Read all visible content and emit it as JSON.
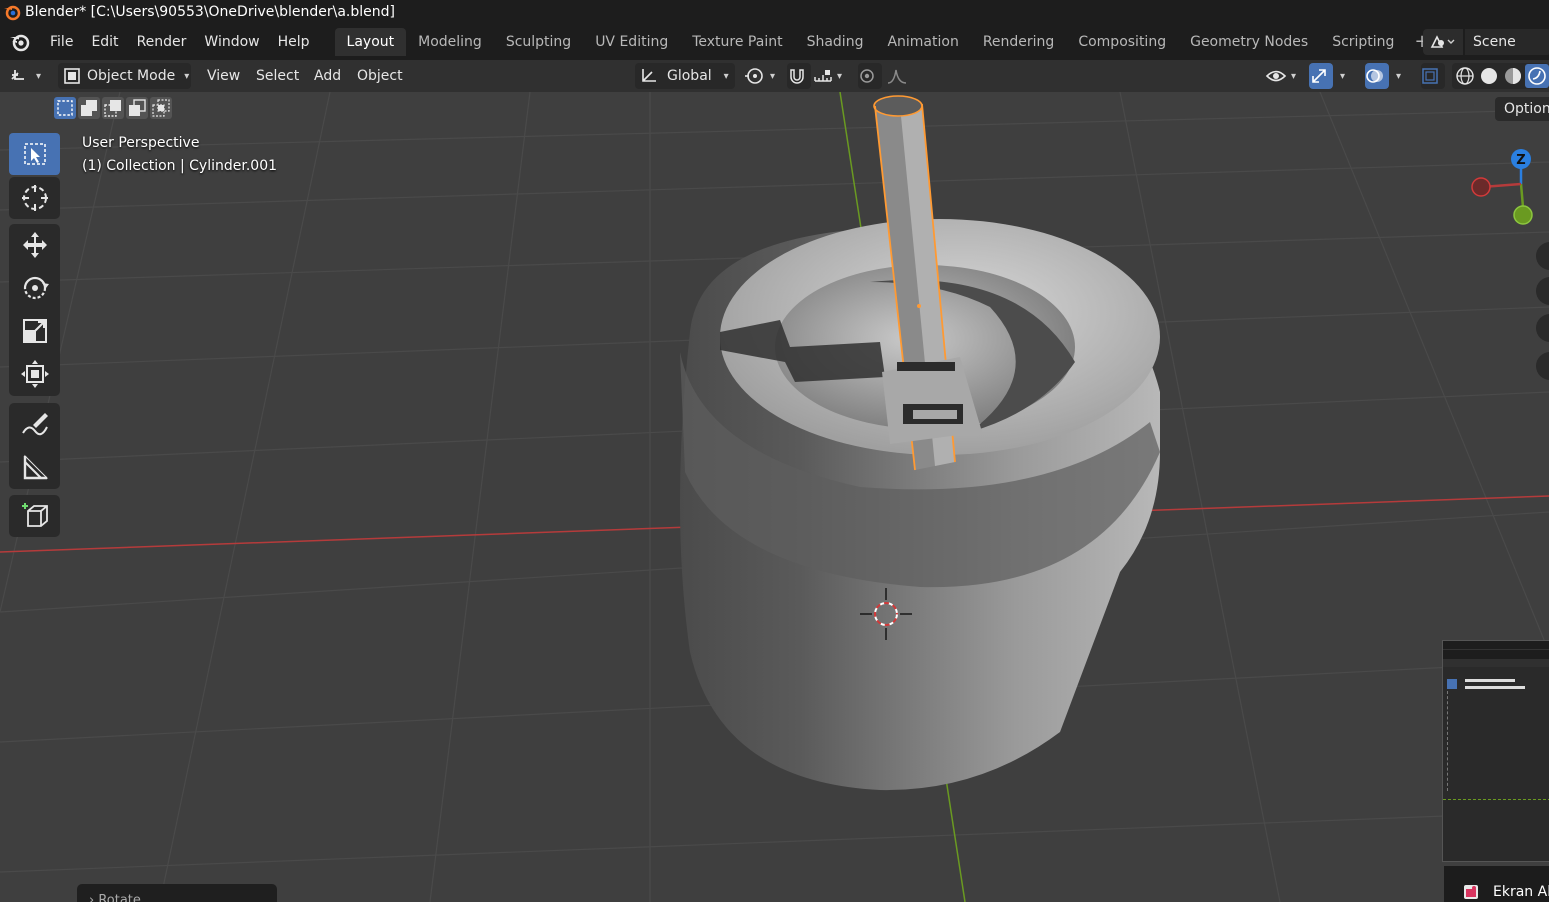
{
  "titlebar": {
    "title": "Blender* [C:\\Users\\90553\\OneDrive\\blender\\a.blend]"
  },
  "menu": {
    "items": [
      "File",
      "Edit",
      "Render",
      "Window",
      "Help"
    ]
  },
  "workspaces": {
    "tabs": [
      "Layout",
      "Modeling",
      "Sculpting",
      "UV Editing",
      "Texture Paint",
      "Shading",
      "Animation",
      "Rendering",
      "Compositing",
      "Geometry Nodes",
      "Scripting"
    ],
    "active": "Layout",
    "add_symbol": "+"
  },
  "scene": {
    "name": "Scene"
  },
  "header": {
    "mode": "Object Mode",
    "view": "View",
    "select": "Select",
    "add": "Add",
    "object": "Object",
    "orientation": "Global"
  },
  "toolsettings": {
    "options_label": "Options"
  },
  "viewport": {
    "perspective_label": "User Perspective",
    "collection_label": "(1) Collection | Cylinder.001",
    "gizmo_axis_label": "Z"
  },
  "operator_panel": {
    "label": "Rotate"
  },
  "notification": {
    "label": "Ekran Al"
  },
  "colors": {
    "accent": "#4772b3",
    "selection_outline": "#ff9a33",
    "axis_x": "#b53b3b",
    "axis_y": "#6a9a21",
    "axis_z": "#2a7fe0"
  }
}
